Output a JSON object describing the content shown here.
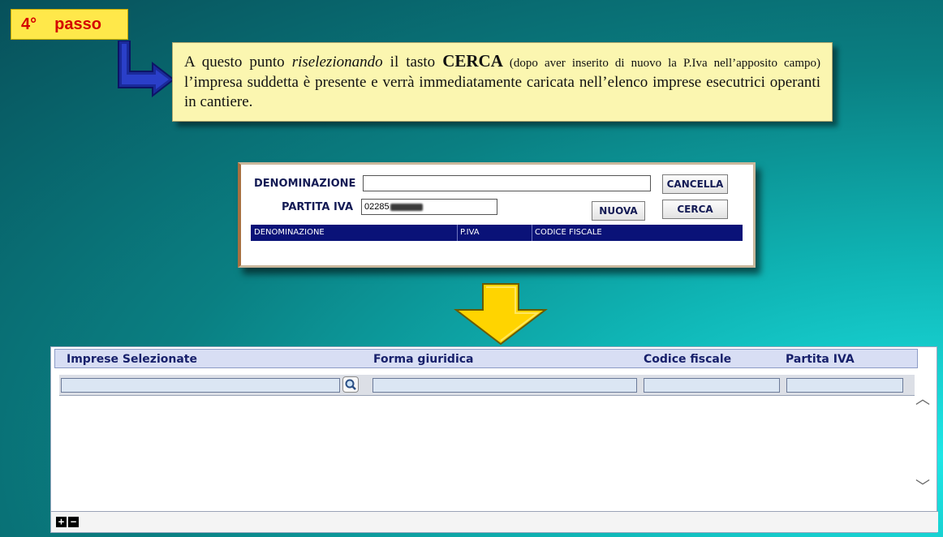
{
  "step": {
    "number": "4°",
    "label": "passo"
  },
  "note": {
    "p1": "A questo punto ",
    "p2_italic": "riselezionando",
    "p3": " il tasto ",
    "p4_bold": "CERCA",
    "p5_small": " (dopo aver inserito di nuovo la P.Iva nell’apposito campo)",
    "p6": " l’impresa suddetta è presente e verrà immediatamente caricata nell’elenco imprese esecutrici operanti in cantiere."
  },
  "search_panel": {
    "denominazione_label": "DENOMINAZIONE",
    "denominazione_value": "",
    "partita_iva_label": "PARTITA IVA",
    "partita_iva_value": "02285",
    "buttons": {
      "cancella": "CANCELLA",
      "nuova": "NUOVA",
      "cerca": "CERCA"
    },
    "columns": [
      "DENOMINAZIONE",
      "P.IVA",
      "CODICE FISCALE"
    ]
  },
  "results_panel": {
    "columns": [
      "Imprese Selezionate",
      "Forma giuridica",
      "Codice fiscale",
      "Partita IVA"
    ],
    "add_label": "+",
    "remove_label": "−"
  },
  "colors": {
    "step_bg": "#ffe84a",
    "step_text": "#d40000",
    "note_bg": "#fbf6b0",
    "arrow": "#ffd400",
    "table_header": "#0a1278"
  },
  "icons": [
    "bent-arrow-icon",
    "down-arrow-icon",
    "search-magnifier-icon",
    "scroll-up-icon",
    "scroll-down-icon"
  ]
}
